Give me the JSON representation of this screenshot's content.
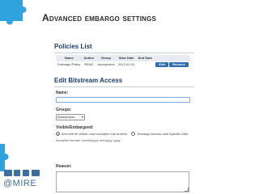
{
  "slide": {
    "title": "Advanced embargo settings",
    "logo_text": "@MIRE",
    "colors": {
      "accent": "#2ea3dd",
      "logo": "#3a6f9f"
    }
  },
  "screen": {
    "policies_title": "Policies List",
    "table": {
      "headers": [
        "Name",
        "Action",
        "Group",
        "Start Date",
        "End Date"
      ],
      "rows": [
        {
          "name": "Embargo Policy",
          "action": "READ",
          "group": "Anonymous",
          "start_date": "2012-01-01",
          "end_date": "",
          "edit": "Edit",
          "remove": "Remove"
        }
      ]
    },
    "edit_title": "Edit Bitstream Access",
    "name_label": "Name:",
    "name_value": "",
    "groups_label": "Groups:",
    "groups_selected": "Anonymous",
    "visible_label": "Visible/Embargoed:",
    "radio_1": "Item will be visible once accepted into archive",
    "radio_2": "Embargo Access until Specific Date",
    "date_format": "Accepted format: mm/dd/yyyy mm/yyyy, yyyy",
    "reason_label": "Reason:",
    "reason_value": ""
  }
}
